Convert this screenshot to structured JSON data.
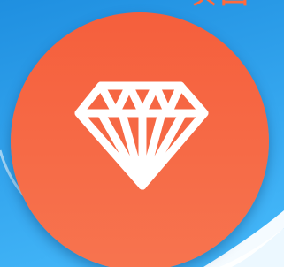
{
  "background": {
    "color_top": "#1f8fe0",
    "color_bottom": "#41b4f7",
    "header_text": "项目",
    "header_text_color": "#ff6a3d"
  },
  "badge": {
    "color_top": "#f55f3c",
    "color_bottom": "#f7744f",
    "icon_name": "diamond-icon",
    "icon_color": "#ffffff"
  }
}
